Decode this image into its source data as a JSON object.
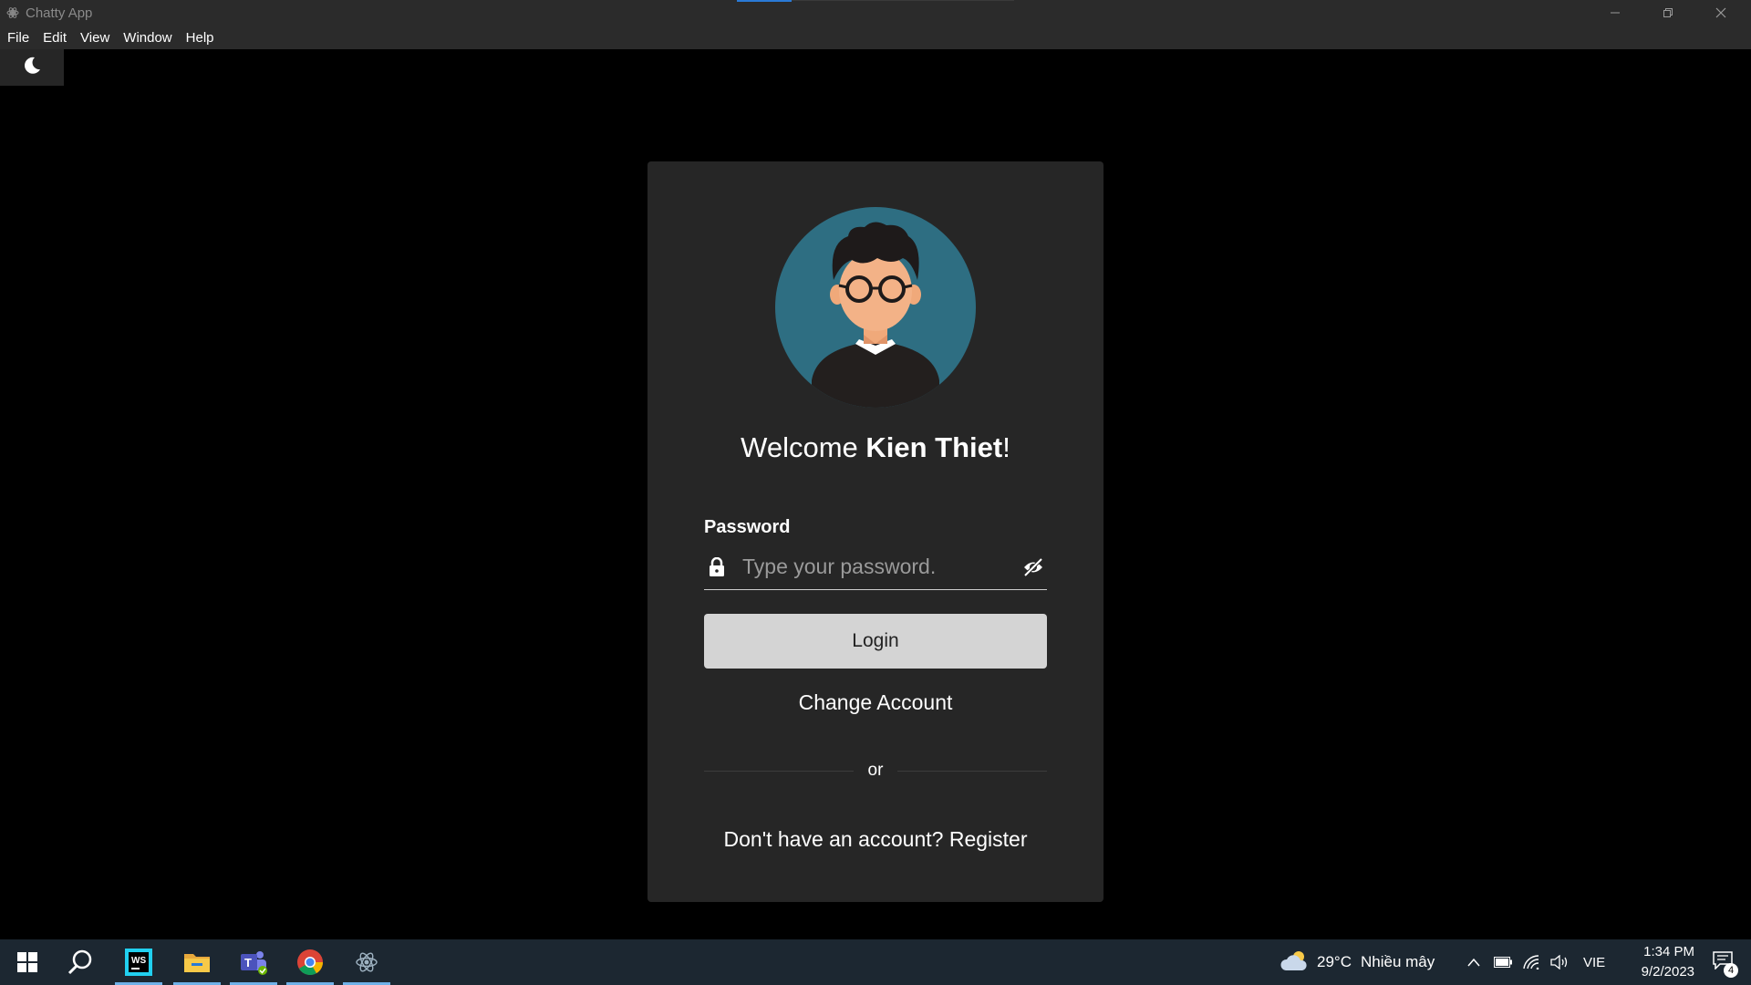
{
  "window": {
    "title": "Chatty App",
    "menu": [
      "File",
      "Edit",
      "View",
      "Window",
      "Help"
    ]
  },
  "theme_toggle": {
    "icon": "moon-icon"
  },
  "login": {
    "welcome_prefix": "Welcome ",
    "user_name": "Kien Thiet",
    "welcome_suffix": "!",
    "password_label": "Password",
    "password_placeholder": "Type your password.",
    "password_value": "",
    "login_label": "Login",
    "change_account_label": "Change Account",
    "divider_label": "or",
    "register_label": "Don't have an account? Register"
  },
  "taskbar": {
    "apps": [
      "windows-start-icon",
      "search-icon",
      "webstorm-icon",
      "file-explorer-icon",
      "teams-icon",
      "chrome-icon",
      "electron-app-icon"
    ],
    "weather_temp": "29°C",
    "weather_desc": "Nhiều mây",
    "language": "VIE",
    "time": "1:34 PM",
    "date": "9/2/2023",
    "notification_count": "4"
  },
  "colors": {
    "background": "#000000",
    "card": "#262626",
    "titlebar": "#2b2b2b",
    "avatar_bg": "#2e6e82",
    "login_button": "#d4d4d4",
    "taskbar": "#1c2731",
    "taskbar_accent": "#6fb1e8"
  }
}
